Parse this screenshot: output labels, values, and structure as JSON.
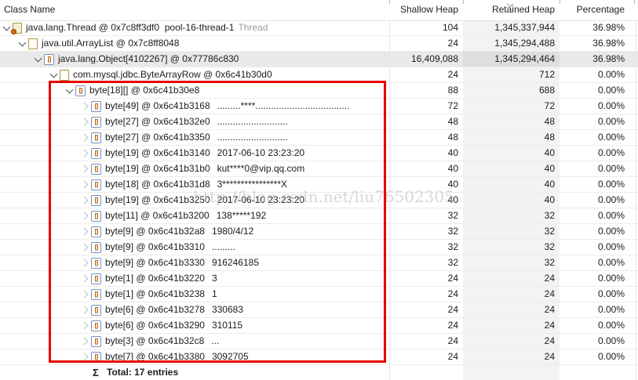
{
  "header": {
    "columns": [
      "Class Name",
      "Shallow Heap",
      "Retained Heap",
      "Percentage"
    ],
    "sorted_column": "Retained Heap",
    "sort_direction": "desc"
  },
  "watermark": "http://blog.csdn.net/liu76502305",
  "total_row": {
    "sigma": "Σ",
    "label": "Total: 17 entries"
  },
  "annotation": {
    "shape": "rectangle",
    "color": "#e80000"
  },
  "colors": {
    "row_highlight": "#e9e9e9",
    "retained_column_shade": "#f3f3f3",
    "annotation_red": "#e80000",
    "gc_root_suffix_gray": "#9b9b9b"
  },
  "rows": [
    {
      "level": 0,
      "chevron": "expanded",
      "icon": "thread",
      "label": "java.lang.Thread @ 0x7c8ff3df0  pool-16-thread-1",
      "preview": "",
      "suffix": "Thread",
      "shallow": "104",
      "retained": "1,345,337,944",
      "percentage": "36.98%",
      "highlighted": false
    },
    {
      "level": 1,
      "chevron": "expanded",
      "icon": "page",
      "label": "java.util.ArrayList @ 0x7c8ff8048",
      "preview": "",
      "suffix": "",
      "shallow": "24",
      "retained": "1,345,294,488",
      "percentage": "36.98%",
      "highlighted": false
    },
    {
      "level": 2,
      "chevron": "expanded",
      "icon": "array",
      "label": "java.lang.Object[4102267] @ 0x77786c830",
      "preview": "",
      "suffix": "",
      "shallow": "16,409,088",
      "retained": "1,345,294,464",
      "percentage": "36.98%",
      "highlighted": true
    },
    {
      "level": 3,
      "chevron": "expanded",
      "icon": "page",
      "label": "com.mysql.jdbc.ByteArrayRow @ 0x6c41b30d0",
      "preview": "",
      "suffix": "",
      "shallow": "24",
      "retained": "712",
      "percentage": "0.00%",
      "highlighted": false
    },
    {
      "level": 4,
      "chevron": "expanded",
      "icon": "array",
      "label": "byte[18][] @ 0x6c41b30e8",
      "preview": "",
      "suffix": "",
      "shallow": "88",
      "retained": "688",
      "percentage": "0.00%",
      "highlighted": false
    },
    {
      "level": 5,
      "chevron": "collapsed",
      "icon": "array",
      "label": "byte[49] @ 0x6c41b3168",
      "preview": ".........****....................................",
      "suffix": "",
      "shallow": "72",
      "retained": "72",
      "percentage": "0.00%",
      "highlighted": false
    },
    {
      "level": 5,
      "chevron": "collapsed",
      "icon": "array",
      "label": "byte[27] @ 0x6c41b32e0",
      "preview": "...........................",
      "suffix": "",
      "shallow": "48",
      "retained": "48",
      "percentage": "0.00%",
      "highlighted": false
    },
    {
      "level": 5,
      "chevron": "collapsed",
      "icon": "array",
      "label": "byte[27] @ 0x6c41b3350",
      "preview": "...........................",
      "suffix": "",
      "shallow": "48",
      "retained": "48",
      "percentage": "0.00%",
      "highlighted": false
    },
    {
      "level": 5,
      "chevron": "collapsed",
      "icon": "array",
      "label": "byte[19] @ 0x6c41b3140",
      "preview": "2017-06-10 23:23:20",
      "suffix": "",
      "shallow": "40",
      "retained": "40",
      "percentage": "0.00%",
      "highlighted": false
    },
    {
      "level": 5,
      "chevron": "collapsed",
      "icon": "array",
      "label": "byte[19] @ 0x6c41b31b0",
      "preview": "kut****0@vip.qq.com",
      "suffix": "",
      "shallow": "40",
      "retained": "40",
      "percentage": "0.00%",
      "highlighted": false
    },
    {
      "level": 5,
      "chevron": "collapsed",
      "icon": "array",
      "label": "byte[18] @ 0x6c41b31d8",
      "preview": "3****************X",
      "suffix": "",
      "shallow": "40",
      "retained": "40",
      "percentage": "0.00%",
      "highlighted": false
    },
    {
      "level": 5,
      "chevron": "collapsed",
      "icon": "array",
      "label": "byte[19] @ 0x6c41b3250",
      "preview": "2017-06-10 23:23:20",
      "suffix": "",
      "shallow": "40",
      "retained": "40",
      "percentage": "0.00%",
      "highlighted": false
    },
    {
      "level": 5,
      "chevron": "collapsed",
      "icon": "array",
      "label": "byte[11] @ 0x6c41b3200",
      "preview": "138*****192",
      "suffix": "",
      "shallow": "32",
      "retained": "32",
      "percentage": "0.00%",
      "highlighted": false
    },
    {
      "level": 5,
      "chevron": "collapsed",
      "icon": "array",
      "label": "byte[9] @ 0x6c41b32a8",
      "preview": "1980/4/12",
      "suffix": "",
      "shallow": "32",
      "retained": "32",
      "percentage": "0.00%",
      "highlighted": false
    },
    {
      "level": 5,
      "chevron": "collapsed",
      "icon": "array",
      "label": "byte[9] @ 0x6c41b3310",
      "preview": ".........",
      "suffix": "",
      "shallow": "32",
      "retained": "32",
      "percentage": "0.00%",
      "highlighted": false
    },
    {
      "level": 5,
      "chevron": "collapsed",
      "icon": "array",
      "label": "byte[9] @ 0x6c41b3330",
      "preview": "916246185",
      "suffix": "",
      "shallow": "32",
      "retained": "32",
      "percentage": "0.00%",
      "highlighted": false
    },
    {
      "level": 5,
      "chevron": "collapsed",
      "icon": "array",
      "label": "byte[1] @ 0x6c41b3220",
      "preview": "3",
      "suffix": "",
      "shallow": "24",
      "retained": "24",
      "percentage": "0.00%",
      "highlighted": false
    },
    {
      "level": 5,
      "chevron": "collapsed",
      "icon": "array",
      "label": "byte[1] @ 0x6c41b3238",
      "preview": "1",
      "suffix": "",
      "shallow": "24",
      "retained": "24",
      "percentage": "0.00%",
      "highlighted": false
    },
    {
      "level": 5,
      "chevron": "collapsed",
      "icon": "array",
      "label": "byte[6] @ 0x6c41b3278",
      "preview": "330683",
      "suffix": "",
      "shallow": "24",
      "retained": "24",
      "percentage": "0.00%",
      "highlighted": false
    },
    {
      "level": 5,
      "chevron": "collapsed",
      "icon": "array",
      "label": "byte[6] @ 0x6c41b3290",
      "preview": "310115",
      "suffix": "",
      "shallow": "24",
      "retained": "24",
      "percentage": "0.00%",
      "highlighted": false
    },
    {
      "level": 5,
      "chevron": "collapsed",
      "icon": "array",
      "label": "byte[3] @ 0x6c41b32c8",
      "preview": "...",
      "suffix": "",
      "shallow": "24",
      "retained": "24",
      "percentage": "0.00%",
      "highlighted": false
    },
    {
      "level": 5,
      "chevron": "collapsed",
      "icon": "array",
      "label": "byte[7] @ 0x6c41b3380",
      "preview": "3092705",
      "suffix": "",
      "shallow": "24",
      "retained": "24",
      "percentage": "0.00%",
      "highlighted": false
    }
  ]
}
